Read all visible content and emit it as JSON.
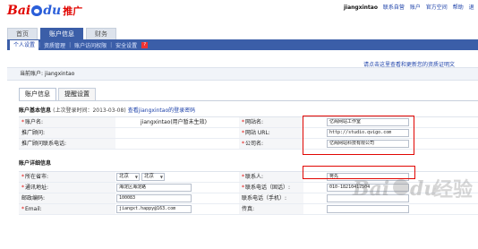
{
  "logo": {
    "part1": "Bai",
    "part2": "du",
    "product": "推广"
  },
  "user": {
    "name": "jiangxintao",
    "links": [
      "联系自营",
      "账户",
      "官方空间",
      "帮助",
      "退"
    ]
  },
  "main_tabs": [
    {
      "label": "首页",
      "active": false
    },
    {
      "label": "账户信息",
      "active": true
    },
    {
      "label": "财务",
      "active": false
    }
  ],
  "sub_nav": {
    "items": [
      "个人设置",
      "资质管理",
      "账户访问权限",
      "安全设置"
    ],
    "help_glyph": "?"
  },
  "notice_text": "请点击这里查看和更新您的资质证明文",
  "current_account": {
    "label": "当前账户:",
    "value": "jiangxintao"
  },
  "inner_tabs": [
    {
      "label": "账户信息",
      "active": true
    },
    {
      "label": "提醒设置",
      "active": false
    }
  ],
  "basic_section": {
    "title": "账户基本信息",
    "last_login_label": "(上次登录时间：2013-03-08)",
    "login_records_link": "查看jiangxintao的登录密码"
  },
  "basic_rows": [
    {
      "left_label": "账户名:",
      "left_req": true,
      "left_value": "jiangxintao(用户暂未生效)",
      "right_label": "网站名:",
      "right_req": true,
      "right_value": "亿阁网站工作室"
    },
    {
      "left_label": "推广顾问:",
      "left_req": false,
      "left_value": "",
      "right_label": "网站 URL:",
      "right_req": true,
      "right_value": "http://studio.qvigo.com"
    },
    {
      "left_label": "推广顾问联系电话:",
      "left_req": false,
      "left_value": "",
      "right_label": "公司名:",
      "right_req": true,
      "right_value": "亿阁网站科技有限公司"
    }
  ],
  "detail_section": {
    "title": "账户详细信息"
  },
  "detail_rows": {
    "location": {
      "label": "所在省市:",
      "req": true,
      "province": "北京",
      "city": "北京"
    },
    "contact": {
      "label": "联系人:",
      "req": true,
      "value": "蒋先"
    },
    "address": {
      "label": "通讯地址:",
      "req": true,
      "value": "海淀区海淀路"
    },
    "phone": {
      "label": "联系电话（固话）:",
      "req": true,
      "value": "010-18210417504"
    },
    "zip": {
      "label": "邮政编码:",
      "req": false,
      "value": "100083"
    },
    "mobile": {
      "label": "联系电话（手机）:",
      "req": false,
      "value": ""
    },
    "email": {
      "label": "Email:",
      "req": true,
      "value": "jiangxt.happy@163.com"
    },
    "fax": {
      "label": "传真:",
      "req": false,
      "value": ""
    }
  },
  "watermark": {
    "text1": "Bai",
    "text2": "du",
    "text3": "经验"
  },
  "colors": {
    "nav_blue": "#3b5ea8",
    "highlight_red": "#e10602",
    "link_blue": "#1a3fa8"
  }
}
